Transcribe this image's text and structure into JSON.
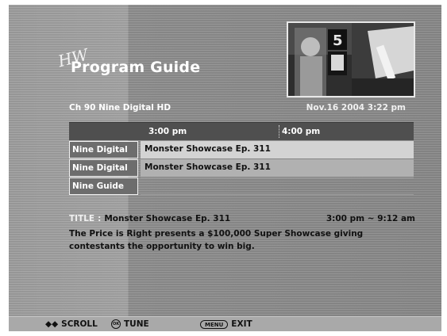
{
  "logo_mark": "HW",
  "guide_title": "Program Guide",
  "channel_name": "Ch 90 Nine Digital HD",
  "date_time": "Nov.16 2004  3:22 pm",
  "grid": {
    "times": [
      "3:00 pm",
      "4:00 pm"
    ],
    "rows": [
      {
        "channel": "Nine Digital",
        "program": "Monster Showcase Ep. 311",
        "state": "selected"
      },
      {
        "channel": "Nine Digital",
        "program": "Monster Showcase Ep. 311",
        "state": "normal"
      },
      {
        "channel": "Nine Guide",
        "program": "",
        "state": "empty"
      }
    ]
  },
  "info": {
    "title_label": "TITLE",
    "title_separator": ":",
    "program_title": "Monster Showcase Ep. 311",
    "time_range": "3:00 pm ~ 9:12 am",
    "description": "The Price is Right presents a $100,000 Super Showcase giving contestants the opportunity to win big."
  },
  "preview": {
    "sign_text": "5"
  },
  "bottom_bar": {
    "scroll_icon": "◆◆",
    "scroll_label": "SCROLL",
    "tune_icon": "OK",
    "tune_label": "TUNE",
    "menu_icon": "MENU",
    "exit_label": "EXIT"
  },
  "colors": {
    "header_bar": "#4f4f4f",
    "selected_row": "#d3d3d3",
    "normal_row": "#b1b1b1",
    "title_label": "#f0f0f0"
  }
}
